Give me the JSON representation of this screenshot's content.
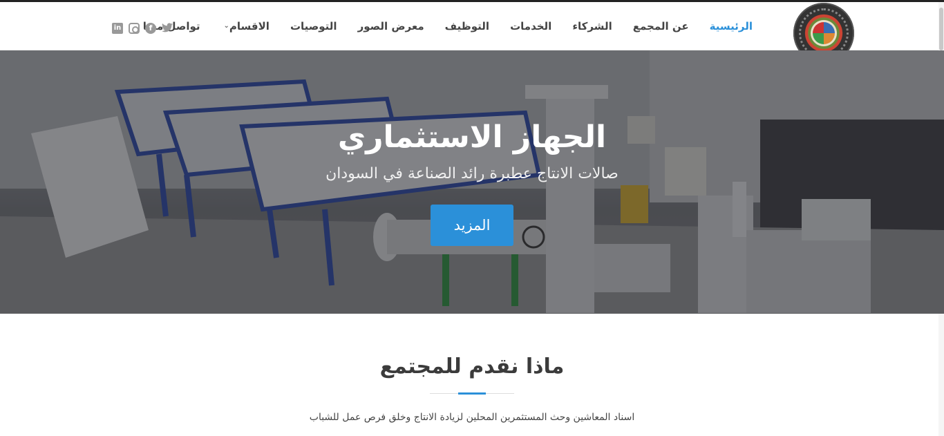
{
  "header": {
    "logo_alt": "ATBARA - PRODUCTION HALLS",
    "nav": [
      {
        "label": "الرئيسية",
        "active": true
      },
      {
        "label": "عن المجمع"
      },
      {
        "label": "الشركاء"
      },
      {
        "label": "الخدمات"
      },
      {
        "label": "التوظيف"
      },
      {
        "label": "معرض الصور"
      },
      {
        "label": "التوصيات"
      },
      {
        "label": "الاقسام",
        "has_dropdown": true
      },
      {
        "label": "تواصل معنا"
      }
    ],
    "social": [
      "twitter-icon",
      "facebook-icon",
      "instagram-icon",
      "linkedin-icon"
    ]
  },
  "hero": {
    "title": "الجهاز الاستثماري",
    "subtitle": "صالات الانتاج عطبرة رائد الصناعة في السودان",
    "button_label": "المزيد"
  },
  "section": {
    "title": "ماذا نقدم للمجتمع",
    "text": "اسناد المعاشين وحث المستثمرين المحلين لزيادة الانتاج وخلق فرص عمل للشباب"
  },
  "colors": {
    "accent": "#2b90d9",
    "text": "#444444"
  }
}
